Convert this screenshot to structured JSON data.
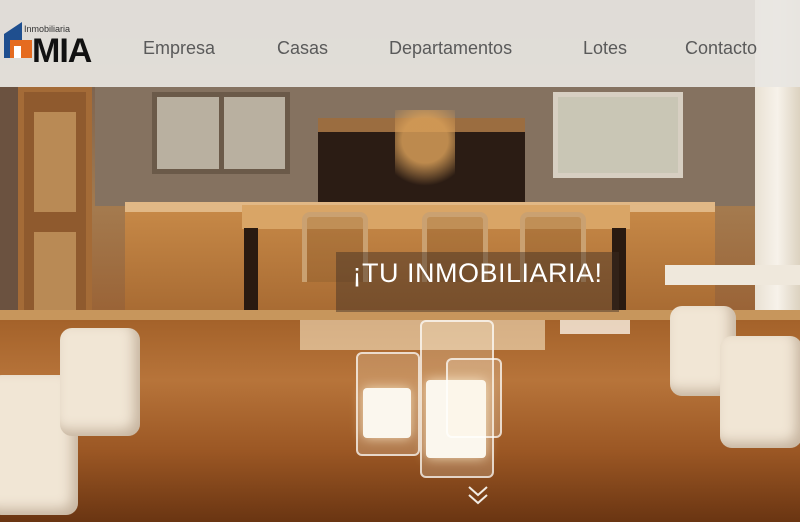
{
  "logo": {
    "small_text": "Inmobiliaria",
    "big_text": "MIA",
    "colors": {
      "orange": "#e56b1f",
      "blue": "#1f4f8f",
      "dark": "#1a1a1a"
    }
  },
  "nav": {
    "items": [
      {
        "label": "Empresa"
      },
      {
        "label": "Casas"
      },
      {
        "label": "Departamentos"
      },
      {
        "label": "Lotes"
      },
      {
        "label": "Contacto"
      }
    ]
  },
  "hero": {
    "headline": "¡TU INMOBILIARIA!",
    "scroll_icon": "double-chevron-down-icon"
  },
  "colors": {
    "header_bg": "#e8e6e2",
    "nav_text": "#5a5a5a",
    "headline_text": "#ffffff"
  }
}
